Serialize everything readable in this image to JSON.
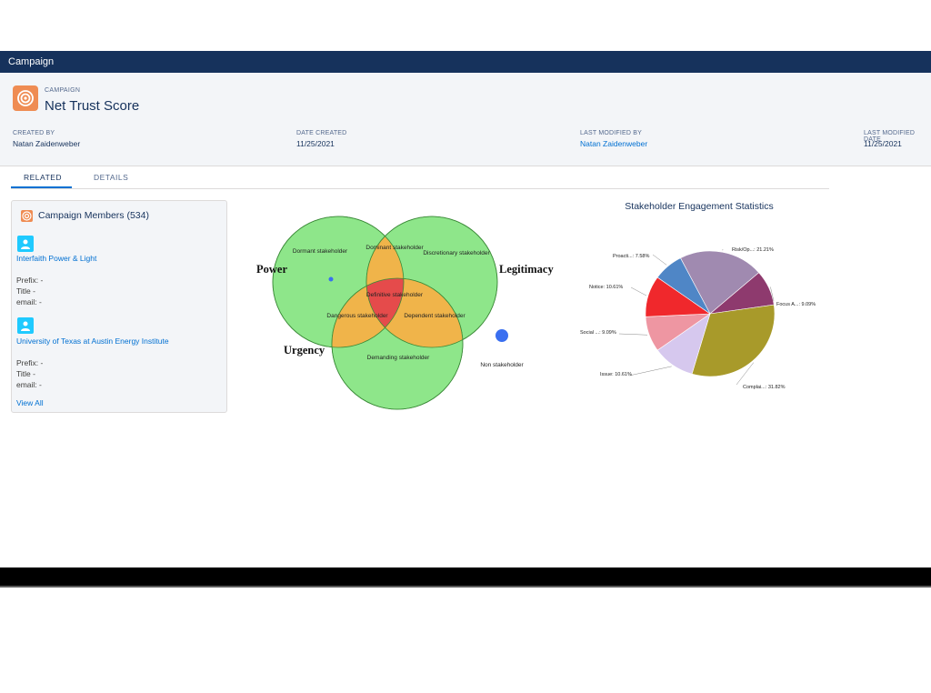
{
  "app": {
    "title": "Campaign"
  },
  "record": {
    "object_label": "CAMPAIGN",
    "title": "Net Trust Score",
    "fields": [
      {
        "label": "CREATED BY",
        "value": "Natan Zaidenweber"
      },
      {
        "label": "DATE CREATED",
        "value": "11/25/2021"
      },
      {
        "label": "LAST MODIFIED BY",
        "value": "Natan Zaidenweber"
      },
      {
        "label": "LAST MODIFIED DATE",
        "value": "11/25/2021"
      }
    ]
  },
  "tabs": [
    {
      "label": "RELATED",
      "active": true
    },
    {
      "label": "DETAILS",
      "active": false
    }
  ],
  "members_card": {
    "title": "Campaign Members (534)",
    "items": [
      {
        "name": "Interfaith Power & Light",
        "prefix": "Prefix: -",
        "title": "Title -",
        "email": "email: -"
      },
      {
        "name": "University of Texas at Austin Energy Institute",
        "prefix": "Prefix: -",
        "title": "Title -",
        "email": "email: -"
      }
    ],
    "view_all": "View All"
  },
  "venn": {
    "set_labels": {
      "power": "Power",
      "legitimacy": "Legitimacy",
      "urgency": "Urgency"
    },
    "regions": {
      "dormant": "Dormant stakeholder",
      "dominant": "Dominant stakeholder",
      "discretionary": "Discretionary stakeholder",
      "definitive": "Definitive stakeholder",
      "dangerous": "Dangerous stakeholder",
      "dependent": "Dependent stakeholder",
      "demanding": "Demanding stakeholder",
      "non": "Non stakeholder"
    },
    "colors": {
      "single": "#8ee68a",
      "double": "#f0b44a",
      "triple": "#e54b4b",
      "dot": "#3a6ff0"
    }
  },
  "chart_data": {
    "type": "pie",
    "title": "Stakeholder Engagement Statistics",
    "slices": [
      {
        "label": "Risk/Op...: 21.21%",
        "value": 21.21,
        "color": "#a08ab0"
      },
      {
        "label": "Focus A...: 9.09%",
        "value": 9.09,
        "color": "#8e3a6e"
      },
      {
        "label": "Complai...: 31.82%",
        "value": 31.82,
        "color": "#a89a2a"
      },
      {
        "label": "Issue: 10.61%",
        "value": 10.61,
        "color": "#d6c8ee"
      },
      {
        "label": "Social ...: 9.09%",
        "value": 9.09,
        "color": "#ee96a2"
      },
      {
        "label": "Notice: 10.61%",
        "value": 10.61,
        "color": "#f0282c"
      },
      {
        "label": "Proacti...: 7.58%",
        "value": 7.58,
        "color": "#4f86c6"
      }
    ]
  }
}
